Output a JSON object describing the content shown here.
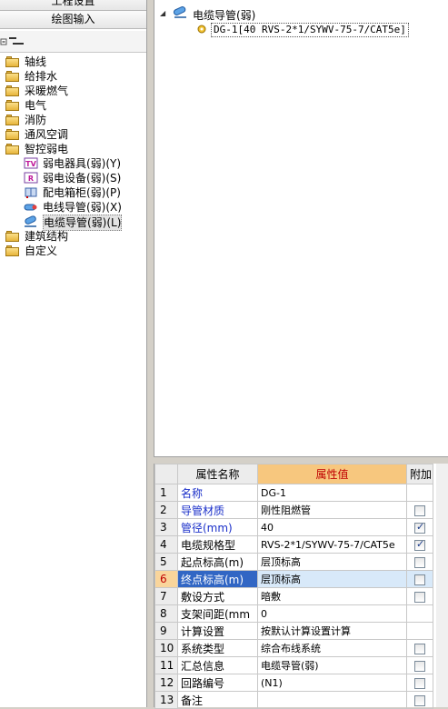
{
  "nav": {
    "project_settings": "工程设置",
    "drawing_input": "绘图输入"
  },
  "left_tree": {
    "items": [
      {
        "label": "轴线",
        "icon": "folder-icon"
      },
      {
        "label": "给排水",
        "icon": "folder-icon"
      },
      {
        "label": "采暖燃气",
        "icon": "folder-icon"
      },
      {
        "label": "电气",
        "icon": "folder-icon"
      },
      {
        "label": "消防",
        "icon": "folder-icon"
      },
      {
        "label": "通风空调",
        "icon": "folder-icon"
      },
      {
        "label": "智控弱电",
        "icon": "folder-open-icon"
      },
      {
        "label": "弱电器具(弱)(Y)",
        "icon": "tv-icon"
      },
      {
        "label": "弱电设备(弱)(S)",
        "icon": "device-icon"
      },
      {
        "label": "配电箱柜(弱)(P)",
        "icon": "cabinet-icon"
      },
      {
        "label": "电线导管(弱)(X)",
        "icon": "wire-conduit-icon"
      },
      {
        "label": "电缆导管(弱)(L)",
        "icon": "cable-conduit-icon"
      },
      {
        "label": "建筑结构",
        "icon": "folder-icon"
      },
      {
        "label": "自定义",
        "icon": "folder-icon"
      }
    ]
  },
  "right_tree": {
    "toggle": "◢",
    "root_label": "电缆导管(弱)",
    "child_label": "DG-1[40 RVS-2*1/SYWV-75-7/CAT5e]"
  },
  "grid": {
    "headers": {
      "name": "属性名称",
      "value": "属性值",
      "extra": "附加"
    },
    "rows": [
      {
        "num": "1",
        "name": "名称",
        "value": "DG-1",
        "checkbox": "none",
        "blue": true
      },
      {
        "num": "2",
        "name": "导管材质",
        "value": "刚性阻燃管",
        "checkbox": "off",
        "blue": true
      },
      {
        "num": "3",
        "name": "管径(mm)",
        "value": "40",
        "checkbox": "on",
        "blue": true
      },
      {
        "num": "4",
        "name": "电缆规格型",
        "value": "RVS-2*1/SYWV-75-7/CAT5e",
        "checkbox": "on",
        "blue": false
      },
      {
        "num": "5",
        "name": "起点标高(m)",
        "value": "层顶标高",
        "checkbox": "off",
        "blue": false
      },
      {
        "num": "6",
        "name": "终点标高(m)",
        "value": "层顶标高",
        "checkbox": "off",
        "blue": false,
        "current": true
      },
      {
        "num": "7",
        "name": "敷设方式",
        "value": "暗敷",
        "checkbox": "off",
        "blue": false
      },
      {
        "num": "8",
        "name": "支架间距(mm",
        "value": "0",
        "checkbox": "none",
        "blue": false
      },
      {
        "num": "9",
        "name": "计算设置",
        "value": "按默认计算设置计算",
        "checkbox": "none",
        "blue": false
      },
      {
        "num": "10",
        "name": "系统类型",
        "value": "综合布线系统",
        "checkbox": "off",
        "blue": false
      },
      {
        "num": "11",
        "name": "汇总信息",
        "value": "电缆导管(弱)",
        "checkbox": "off",
        "blue": false
      },
      {
        "num": "12",
        "name": "回路编号",
        "value": "(N1)",
        "checkbox": "off",
        "blue": false
      },
      {
        "num": "13",
        "name": "备注",
        "value": "",
        "checkbox": "off",
        "blue": false
      }
    ]
  }
}
